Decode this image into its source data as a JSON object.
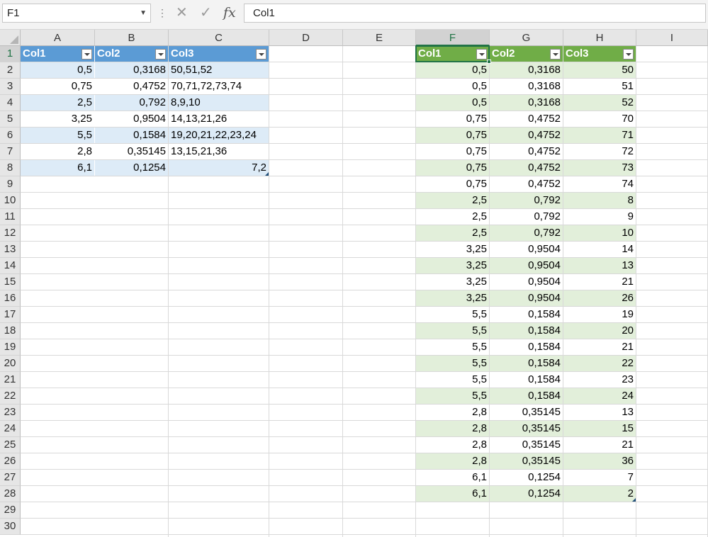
{
  "formula_bar": {
    "name_box": "F1",
    "separator": "⋮",
    "cancel": "✕",
    "enter": "✓",
    "fx": "fx",
    "formula": "Col1"
  },
  "columns": [
    "A",
    "B",
    "C",
    "D",
    "E",
    "F",
    "G",
    "H",
    "I"
  ],
  "selected_column": "F",
  "rows": [
    "1",
    "2",
    "3",
    "4",
    "5",
    "6",
    "7",
    "8",
    "9",
    "10",
    "11",
    "12",
    "13",
    "14",
    "15",
    "16",
    "17",
    "18",
    "19",
    "20",
    "21",
    "22",
    "23",
    "24",
    "25",
    "26",
    "27",
    "28",
    "29",
    "30"
  ],
  "selected_row": "1",
  "colors": {
    "blue_header": "#5b9bd5",
    "blue_band": "#ddebf7",
    "green_header": "#70ad47",
    "green_band": "#e2efda",
    "selection": "#217346"
  },
  "table1": {
    "headers": [
      "Col1",
      "Col2",
      "Col3"
    ],
    "rows": [
      [
        "0,5",
        "0,3168",
        "50,51,52"
      ],
      [
        "0,75",
        "0,4752",
        "70,71,72,73,74"
      ],
      [
        "2,5",
        "0,792",
        "8,9,10"
      ],
      [
        "3,25",
        "0,9504",
        "14,13,21,26"
      ],
      [
        "5,5",
        "0,1584",
        "19,20,21,22,23,24"
      ],
      [
        "2,8",
        "0,35145",
        "13,15,21,36"
      ],
      [
        "6,1",
        "0,1254",
        "7,2"
      ]
    ]
  },
  "table2": {
    "headers": [
      "Col1",
      "Col2",
      "Col3"
    ],
    "rows": [
      [
        "0,5",
        "0,3168",
        "50"
      ],
      [
        "0,5",
        "0,3168",
        "51"
      ],
      [
        "0,5",
        "0,3168",
        "52"
      ],
      [
        "0,75",
        "0,4752",
        "70"
      ],
      [
        "0,75",
        "0,4752",
        "71"
      ],
      [
        "0,75",
        "0,4752",
        "72"
      ],
      [
        "0,75",
        "0,4752",
        "73"
      ],
      [
        "0,75",
        "0,4752",
        "74"
      ],
      [
        "2,5",
        "0,792",
        "8"
      ],
      [
        "2,5",
        "0,792",
        "9"
      ],
      [
        "2,5",
        "0,792",
        "10"
      ],
      [
        "3,25",
        "0,9504",
        "14"
      ],
      [
        "3,25",
        "0,9504",
        "13"
      ],
      [
        "3,25",
        "0,9504",
        "21"
      ],
      [
        "3,25",
        "0,9504",
        "26"
      ],
      [
        "5,5",
        "0,1584",
        "19"
      ],
      [
        "5,5",
        "0,1584",
        "20"
      ],
      [
        "5,5",
        "0,1584",
        "21"
      ],
      [
        "5,5",
        "0,1584",
        "22"
      ],
      [
        "5,5",
        "0,1584",
        "23"
      ],
      [
        "5,5",
        "0,1584",
        "24"
      ],
      [
        "2,8",
        "0,35145",
        "13"
      ],
      [
        "2,8",
        "0,35145",
        "15"
      ],
      [
        "2,8",
        "0,35145",
        "21"
      ],
      [
        "2,8",
        "0,35145",
        "36"
      ],
      [
        "6,1",
        "0,1254",
        "7"
      ],
      [
        "6,1",
        "0,1254",
        "2"
      ]
    ]
  }
}
